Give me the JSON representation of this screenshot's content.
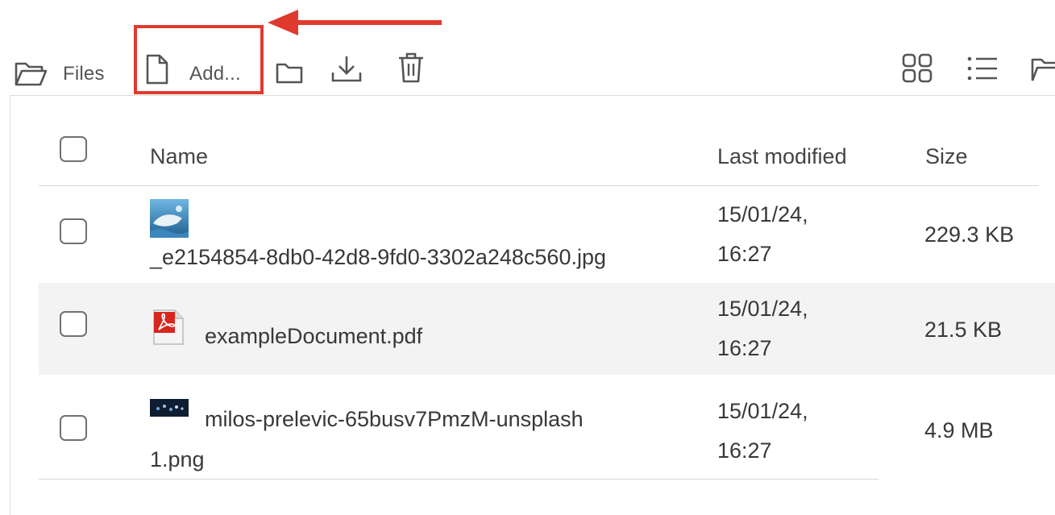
{
  "toolbar": {
    "files_label": "Files",
    "add_label": "Add...",
    "icons": [
      "open-folder-icon",
      "new-file-icon",
      "new-folder-icon",
      "download-icon",
      "trash-icon",
      "grid-view-icon",
      "list-view-icon",
      "folder-icon"
    ]
  },
  "table": {
    "headers": {
      "name": "Name",
      "modified": "Last modified",
      "size": "Size"
    },
    "rows": [
      {
        "thumbnail": "jpg-thumbnail",
        "name": "_e2154854-8db0-42d8-9fd0-3302a248c560.jpg",
        "modified_date": "15/01/24,",
        "modified_time": "16:27",
        "size": "229.3 KB"
      },
      {
        "thumbnail": "pdf-icon",
        "name": "exampleDocument.pdf",
        "modified_date": "15/01/24,",
        "modified_time": "16:27",
        "size": "21.5 KB"
      },
      {
        "thumbnail": "png-thumbnail",
        "name_line1": "milos-prelevic-65busv7PmzM-unsplash",
        "name_line2": "1.png",
        "modified_date": "15/01/24,",
        "modified_time": "16:27",
        "size": "4.9 MB"
      }
    ]
  },
  "colors": {
    "annotation_red": "#e03a2e",
    "row_highlight": "#f3f3f3",
    "icon_gray": "#555555"
  }
}
